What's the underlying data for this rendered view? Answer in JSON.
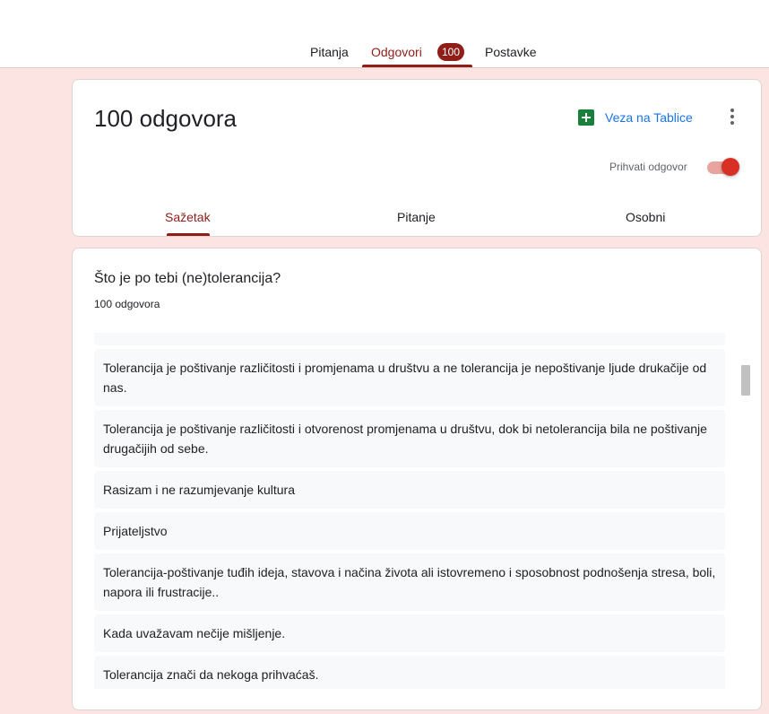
{
  "top_tabs": [
    {
      "label": "Pitanja"
    },
    {
      "label": "Odgovori",
      "badge": "100",
      "active": true
    },
    {
      "label": "Postavke"
    }
  ],
  "header": {
    "title": "100 odgovora",
    "sheets_link": "Veza na Tablice",
    "accept_label": "Prihvati odgovor",
    "accepting": true,
    "sub_tabs": [
      {
        "label": "Sažetak",
        "active": true
      },
      {
        "label": "Pitanje"
      },
      {
        "label": "Osobni"
      }
    ]
  },
  "question": {
    "title": "Što je po tebi (ne)tolerancija?",
    "count": "100 odgovora",
    "answers": [
      "Tolerancija je poštivanje različitosti i promjenama u društvu a ne tolerancija je nepoštivanje ljude drukačije od nas.",
      "Tolerancija je poštivanje različitosti i otvorenost promjenama u društvu, dok bi netolerancija bila ne poštivanje drugačijih od sebe.",
      "Rasizam i ne razumjevanje kultura",
      "Prijateljstvo",
      "Tolerancija-poštivanje tuđih ideja, stavova i načina života ali istovremeno i sposobnost podnošenja stresa, boli, napora ili frustracije..",
      "Kada uvažavam nečije mišljenje.",
      "Tolerancija znači da nekoga prihvaćaš."
    ]
  },
  "colors": {
    "accent": "#8f1e18",
    "background": "#fbe4e2",
    "toggle_on": "#d93025",
    "link": "#1a73e8",
    "sheets_green": "#188038"
  },
  "icons": [
    "sheets-icon",
    "more-vert-icon"
  ]
}
